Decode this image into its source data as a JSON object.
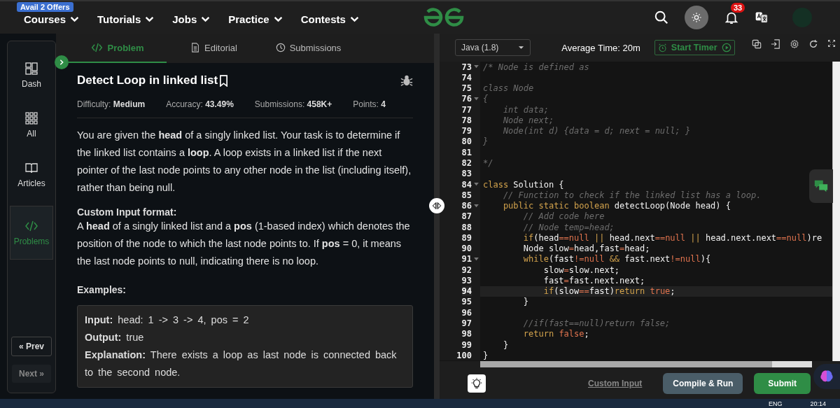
{
  "nav": {
    "offer_badge": "Avail 2 Offers",
    "items": [
      "Courses",
      "Tutorials",
      "Jobs",
      "Practice",
      "Contests"
    ],
    "notification_count": "33"
  },
  "sidebar": {
    "items": [
      {
        "label": "Dash",
        "kind": "dash",
        "selected": false
      },
      {
        "label": "All",
        "kind": "all",
        "selected": false
      },
      {
        "label": "Articles",
        "kind": "articles",
        "selected": false
      },
      {
        "label": "Problems",
        "kind": "problems",
        "selected": true
      }
    ],
    "prev": "« Prev",
    "next": "Next »"
  },
  "tabs": [
    {
      "label": "Problem",
      "kind": "code",
      "selected": true
    },
    {
      "label": "Editorial",
      "kind": "doc",
      "selected": false
    },
    {
      "label": "Submissions",
      "kind": "clock",
      "selected": false
    }
  ],
  "problem": {
    "title": "Detect Loop in linked list",
    "meta": [
      {
        "label": "Difficulty:",
        "value": "Medium"
      },
      {
        "label": "Accuracy:",
        "value": "43.49%"
      },
      {
        "label": "Submissions:",
        "value": "458K+"
      },
      {
        "label": "Points:",
        "value": "4"
      }
    ],
    "description": "You are given the **head** of a singly linked list. Your task is to determine if the linked list contains a **loop**. A loop exists in a linked list if the next pointer of the last node points to any other node in the list (including itself), rather than being null.",
    "custom_input_heading": "Custom Input format:",
    "custom_input": "A **head** of a singly linked list and a **pos** (1-based index) which denotes the position of the node to which the last node points to. If **pos** = 0, it means the last node points to null, indicating there is no loop.",
    "examples_heading": "Examples:",
    "example": [
      {
        "label": "Input:",
        "value": "head: 1 -> 3 -> 4, pos = 2"
      },
      {
        "label": "Output:",
        "value": "true"
      },
      {
        "label": "Explanation:",
        "value": "There exists a loop as last node is connected back to the second node."
      }
    ]
  },
  "editor": {
    "language": "Java (1.8)",
    "average_time": "Average Time: 20m",
    "start_timer": "Start Timer",
    "lines": [
      {
        "number": "73",
        "fold": true,
        "current": false,
        "tokens": [
          {
            "kind": "c",
            "text": "/* Node is defined as"
          }
        ]
      },
      {
        "number": "74",
        "fold": false,
        "current": false
      },
      {
        "number": "75",
        "fold": false,
        "current": false,
        "tokens": [
          {
            "kind": "c",
            "text": "class Node"
          }
        ]
      },
      {
        "number": "76",
        "fold": true,
        "current": false,
        "tokens": [
          {
            "kind": "c",
            "text": "{"
          }
        ]
      },
      {
        "number": "77",
        "fold": false,
        "current": false,
        "tokens": [
          {
            "kind": "c",
            "text": "    int data;"
          }
        ]
      },
      {
        "number": "78",
        "fold": false,
        "current": false,
        "tokens": [
          {
            "kind": "c",
            "text": "    Node next;"
          }
        ]
      },
      {
        "number": "79",
        "fold": false,
        "current": false,
        "tokens": [
          {
            "kind": "c",
            "text": "    Node(int d) {data = d; next = null; }"
          }
        ]
      },
      {
        "number": "80",
        "fold": false,
        "current": false,
        "tokens": [
          {
            "kind": "c",
            "text": "}"
          }
        ]
      },
      {
        "number": "81",
        "fold": false,
        "current": false
      },
      {
        "number": "82",
        "fold": false,
        "current": false,
        "tokens": [
          {
            "kind": "c",
            "text": "*/"
          }
        ]
      },
      {
        "number": "83",
        "fold": false,
        "current": false
      },
      {
        "number": "84",
        "fold": true,
        "current": false,
        "tokens": [
          {
            "kind": "k",
            "text": "class"
          },
          {
            "kind": "n",
            "text": " Solution {"
          }
        ]
      },
      {
        "number": "85",
        "fold": false,
        "current": false,
        "tokens": [
          {
            "kind": "c",
            "text": "    // Function to check if the linked list has a loop."
          }
        ]
      },
      {
        "number": "86",
        "fold": true,
        "current": false,
        "tokens": [
          {
            "kind": "k",
            "text": "    public static boolean"
          },
          {
            "kind": "n",
            "text": " detectLoop(Node head) {"
          }
        ]
      },
      {
        "number": "87",
        "fold": false,
        "current": false,
        "tokens": [
          {
            "kind": "c",
            "text": "        // Add code here"
          }
        ]
      },
      {
        "number": "88",
        "fold": false,
        "current": false,
        "tokens": [
          {
            "kind": "c",
            "text": "        // Node temp=head;"
          }
        ]
      },
      {
        "number": "89",
        "fold": false,
        "current": false,
        "tokens": [
          {
            "kind": "k",
            "text": "        if"
          },
          {
            "kind": "n",
            "text": "(head"
          },
          {
            "kind": "o",
            "text": "=="
          },
          {
            "kind": "o",
            "text": "null"
          },
          {
            "kind": "k",
            "text": " ||"
          },
          {
            "kind": "n",
            "text": " head.next"
          },
          {
            "kind": "o",
            "text": "=="
          },
          {
            "kind": "o",
            "text": "null"
          },
          {
            "kind": "k",
            "text": " ||"
          },
          {
            "kind": "n",
            "text": " head.next.next"
          },
          {
            "kind": "o",
            "text": "=="
          },
          {
            "kind": "o",
            "text": "null"
          },
          {
            "kind": "n",
            "text": ")re"
          }
        ]
      },
      {
        "number": "90",
        "fold": false,
        "current": false,
        "tokens": [
          {
            "kind": "n",
            "text": "        Node slow"
          },
          {
            "kind": "o",
            "text": "="
          },
          {
            "kind": "n",
            "text": "head,fast"
          },
          {
            "kind": "o",
            "text": "="
          },
          {
            "kind": "n",
            "text": "head;"
          }
        ]
      },
      {
        "number": "91",
        "fold": true,
        "current": false,
        "tokens": [
          {
            "kind": "k",
            "text": "        while"
          },
          {
            "kind": "n",
            "text": "(fast"
          },
          {
            "kind": "o",
            "text": "!="
          },
          {
            "kind": "o",
            "text": "null"
          },
          {
            "kind": "k",
            "text": " &&"
          },
          {
            "kind": "n",
            "text": " fast.next"
          },
          {
            "kind": "o",
            "text": "!="
          },
          {
            "kind": "o",
            "text": "null"
          },
          {
            "kind": "n",
            "text": "){"
          }
        ]
      },
      {
        "number": "92",
        "fold": false,
        "current": false,
        "tokens": [
          {
            "kind": "n",
            "text": "            slow"
          },
          {
            "kind": "o",
            "text": "="
          },
          {
            "kind": "n",
            "text": "slow.next;"
          }
        ]
      },
      {
        "number": "93",
        "fold": false,
        "current": false,
        "tokens": [
          {
            "kind": "n",
            "text": "            fast"
          },
          {
            "kind": "o",
            "text": "="
          },
          {
            "kind": "n",
            "text": "fast.next.next;"
          }
        ]
      },
      {
        "number": "94",
        "fold": false,
        "current": true,
        "tokens": [
          {
            "kind": "k",
            "text": "            if"
          },
          {
            "kind": "n",
            "text": "(slow"
          },
          {
            "kind": "o",
            "text": "=="
          },
          {
            "kind": "n",
            "text": "fast)"
          },
          {
            "kind": "k",
            "text": "return"
          },
          {
            "kind": "o",
            "text": " true"
          },
          {
            "kind": "n",
            "text": ";"
          }
        ]
      },
      {
        "number": "95",
        "fold": false,
        "current": false,
        "tokens": [
          {
            "kind": "n",
            "text": "        }"
          }
        ]
      },
      {
        "number": "96",
        "fold": false,
        "current": false
      },
      {
        "number": "97",
        "fold": false,
        "current": false,
        "tokens": [
          {
            "kind": "c",
            "text": "        //if(fast==null)return false;"
          }
        ]
      },
      {
        "number": "98",
        "fold": false,
        "current": false,
        "tokens": [
          {
            "kind": "k",
            "text": "        return"
          },
          {
            "kind": "o",
            "text": " false"
          },
          {
            "kind": "n",
            "text": ";"
          }
        ]
      },
      {
        "number": "99",
        "fold": false,
        "current": false,
        "tokens": [
          {
            "kind": "n",
            "text": "    }"
          }
        ]
      },
      {
        "number": "100",
        "fold": false,
        "current": false,
        "tokens": [
          {
            "kind": "n",
            "text": "}"
          }
        ]
      }
    ],
    "custom_input": "Custom Input",
    "compile_run": "Compile & Run",
    "submit": "Submit"
  },
  "taskbar": {
    "language": "ENG",
    "time": "20:14"
  }
}
